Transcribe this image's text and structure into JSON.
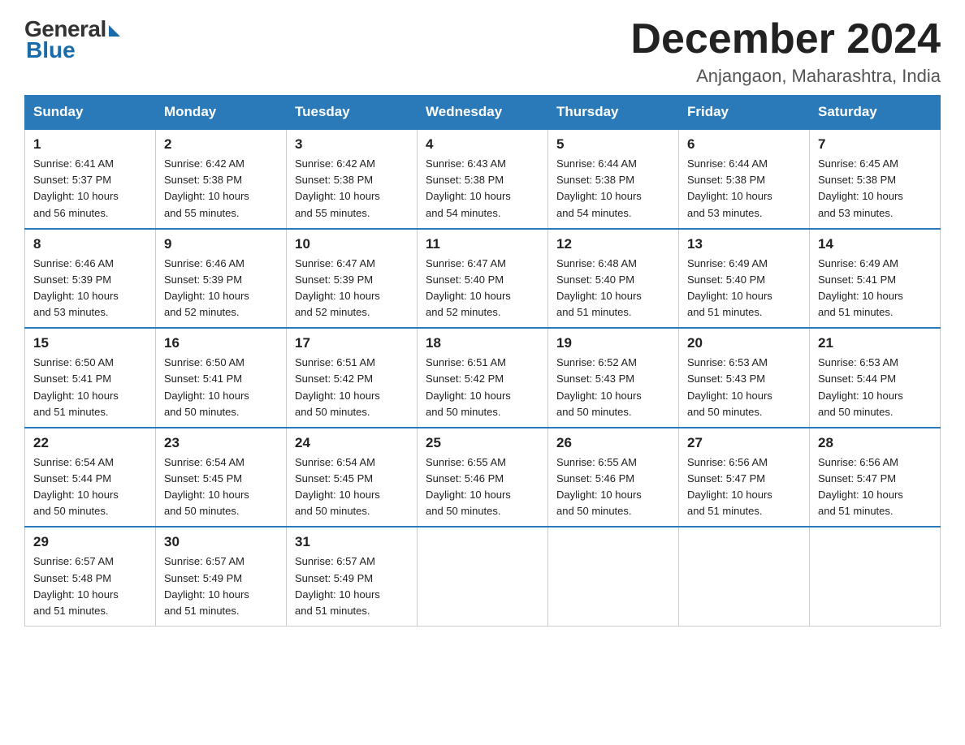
{
  "header": {
    "logo_general": "General",
    "logo_blue": "Blue",
    "month_title": "December 2024",
    "location": "Anjangaon, Maharashtra, India"
  },
  "days_of_week": [
    "Sunday",
    "Monday",
    "Tuesday",
    "Wednesday",
    "Thursday",
    "Friday",
    "Saturday"
  ],
  "weeks": [
    [
      {
        "day": "1",
        "sunrise": "6:41 AM",
        "sunset": "5:37 PM",
        "daylight": "10 hours and 56 minutes."
      },
      {
        "day": "2",
        "sunrise": "6:42 AM",
        "sunset": "5:38 PM",
        "daylight": "10 hours and 55 minutes."
      },
      {
        "day": "3",
        "sunrise": "6:42 AM",
        "sunset": "5:38 PM",
        "daylight": "10 hours and 55 minutes."
      },
      {
        "day": "4",
        "sunrise": "6:43 AM",
        "sunset": "5:38 PM",
        "daylight": "10 hours and 54 minutes."
      },
      {
        "day": "5",
        "sunrise": "6:44 AM",
        "sunset": "5:38 PM",
        "daylight": "10 hours and 54 minutes."
      },
      {
        "day": "6",
        "sunrise": "6:44 AM",
        "sunset": "5:38 PM",
        "daylight": "10 hours and 53 minutes."
      },
      {
        "day": "7",
        "sunrise": "6:45 AM",
        "sunset": "5:38 PM",
        "daylight": "10 hours and 53 minutes."
      }
    ],
    [
      {
        "day": "8",
        "sunrise": "6:46 AM",
        "sunset": "5:39 PM",
        "daylight": "10 hours and 53 minutes."
      },
      {
        "day": "9",
        "sunrise": "6:46 AM",
        "sunset": "5:39 PM",
        "daylight": "10 hours and 52 minutes."
      },
      {
        "day": "10",
        "sunrise": "6:47 AM",
        "sunset": "5:39 PM",
        "daylight": "10 hours and 52 minutes."
      },
      {
        "day": "11",
        "sunrise": "6:47 AM",
        "sunset": "5:40 PM",
        "daylight": "10 hours and 52 minutes."
      },
      {
        "day": "12",
        "sunrise": "6:48 AM",
        "sunset": "5:40 PM",
        "daylight": "10 hours and 51 minutes."
      },
      {
        "day": "13",
        "sunrise": "6:49 AM",
        "sunset": "5:40 PM",
        "daylight": "10 hours and 51 minutes."
      },
      {
        "day": "14",
        "sunrise": "6:49 AM",
        "sunset": "5:41 PM",
        "daylight": "10 hours and 51 minutes."
      }
    ],
    [
      {
        "day": "15",
        "sunrise": "6:50 AM",
        "sunset": "5:41 PM",
        "daylight": "10 hours and 51 minutes."
      },
      {
        "day": "16",
        "sunrise": "6:50 AM",
        "sunset": "5:41 PM",
        "daylight": "10 hours and 50 minutes."
      },
      {
        "day": "17",
        "sunrise": "6:51 AM",
        "sunset": "5:42 PM",
        "daylight": "10 hours and 50 minutes."
      },
      {
        "day": "18",
        "sunrise": "6:51 AM",
        "sunset": "5:42 PM",
        "daylight": "10 hours and 50 minutes."
      },
      {
        "day": "19",
        "sunrise": "6:52 AM",
        "sunset": "5:43 PM",
        "daylight": "10 hours and 50 minutes."
      },
      {
        "day": "20",
        "sunrise": "6:53 AM",
        "sunset": "5:43 PM",
        "daylight": "10 hours and 50 minutes."
      },
      {
        "day": "21",
        "sunrise": "6:53 AM",
        "sunset": "5:44 PM",
        "daylight": "10 hours and 50 minutes."
      }
    ],
    [
      {
        "day": "22",
        "sunrise": "6:54 AM",
        "sunset": "5:44 PM",
        "daylight": "10 hours and 50 minutes."
      },
      {
        "day": "23",
        "sunrise": "6:54 AM",
        "sunset": "5:45 PM",
        "daylight": "10 hours and 50 minutes."
      },
      {
        "day": "24",
        "sunrise": "6:54 AM",
        "sunset": "5:45 PM",
        "daylight": "10 hours and 50 minutes."
      },
      {
        "day": "25",
        "sunrise": "6:55 AM",
        "sunset": "5:46 PM",
        "daylight": "10 hours and 50 minutes."
      },
      {
        "day": "26",
        "sunrise": "6:55 AM",
        "sunset": "5:46 PM",
        "daylight": "10 hours and 50 minutes."
      },
      {
        "day": "27",
        "sunrise": "6:56 AM",
        "sunset": "5:47 PM",
        "daylight": "10 hours and 51 minutes."
      },
      {
        "day": "28",
        "sunrise": "6:56 AM",
        "sunset": "5:47 PM",
        "daylight": "10 hours and 51 minutes."
      }
    ],
    [
      {
        "day": "29",
        "sunrise": "6:57 AM",
        "sunset": "5:48 PM",
        "daylight": "10 hours and 51 minutes."
      },
      {
        "day": "30",
        "sunrise": "6:57 AM",
        "sunset": "5:49 PM",
        "daylight": "10 hours and 51 minutes."
      },
      {
        "day": "31",
        "sunrise": "6:57 AM",
        "sunset": "5:49 PM",
        "daylight": "10 hours and 51 minutes."
      },
      null,
      null,
      null,
      null
    ]
  ],
  "labels": {
    "sunrise": "Sunrise:",
    "sunset": "Sunset:",
    "daylight": "Daylight:"
  }
}
